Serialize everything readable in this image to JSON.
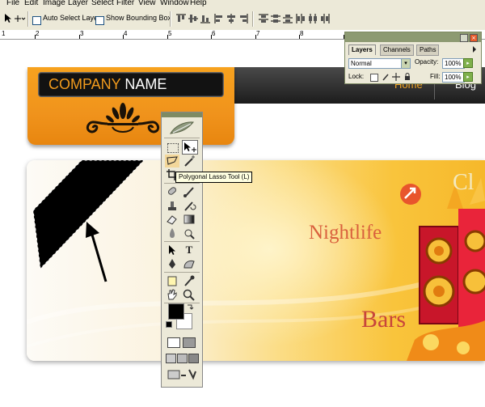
{
  "menu": {
    "items": [
      "File",
      "Edit",
      "Image",
      "Layer",
      "Select",
      "Filter",
      "View",
      "Window",
      "Help"
    ]
  },
  "options_bar": {
    "auto_select_label": "Auto Select Layer",
    "show_bounding_label": "Show Bounding Box"
  },
  "ruler": {
    "numbers": [
      "1",
      "2",
      "3",
      "4",
      "5",
      "6",
      "7",
      "8"
    ]
  },
  "layers_palette": {
    "tabs": [
      "Layers",
      "Channels",
      "Paths"
    ],
    "blend_mode": "Normal",
    "opacity_label": "Opacity:",
    "opacity_value": "100%",
    "lock_label": "Lock:",
    "fill_label": "Fill:",
    "fill_value": "100%"
  },
  "tooltip": {
    "text": "Polygonal Lasso Tool (L)"
  },
  "canvas": {
    "company_part1": "COMPANY",
    "company_part2": " NAME",
    "nav_home": "Home",
    "nav_blog": "Blog",
    "nightlife": "Nightlife",
    "bars": "Bars",
    "club": "Cl"
  },
  "colors": {
    "accent_orange": "#f29b1d",
    "nightlife_red": "#d9603d",
    "nav_orange": "#f5a623"
  },
  "tools": {
    "icons": [
      "marquee-icon",
      "move-icon",
      "polygonal-lasso-icon",
      "magic-wand-icon",
      "crop-icon",
      "slice-icon",
      "healing-brush-icon",
      "brush-icon",
      "clone-stamp-icon",
      "history-brush-icon",
      "eraser-icon",
      "gradient-icon",
      "blur-icon",
      "dodge-icon",
      "path-selection-icon",
      "type-icon",
      "pen-icon",
      "custom-shape-icon",
      "notes-icon",
      "eyedropper-icon",
      "hand-icon",
      "zoom-icon"
    ]
  }
}
